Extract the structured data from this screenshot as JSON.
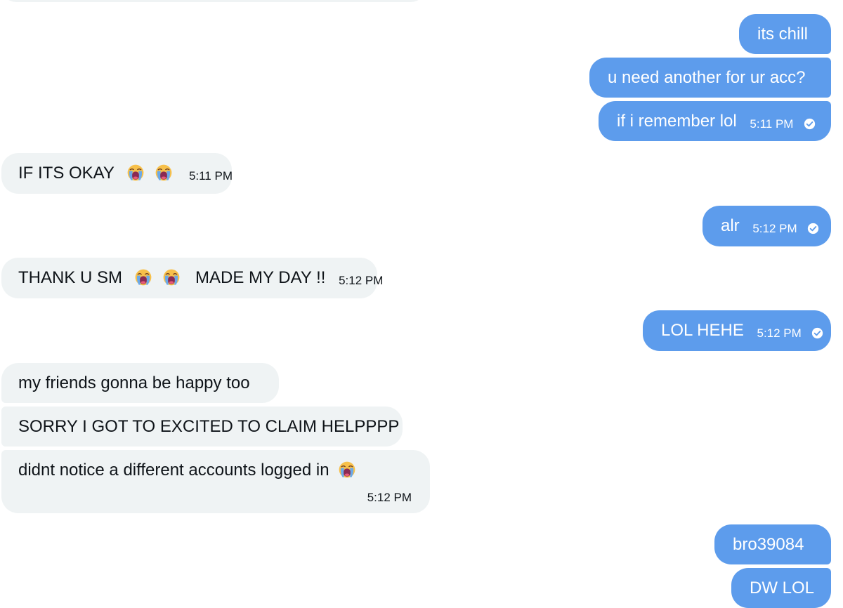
{
  "colors": {
    "incoming_bubble": "#eff3f4",
    "outgoing_bubble": "#5d9cec",
    "incoming_text": "#0f1419",
    "outgoing_text": "#ffffff"
  },
  "icons": {
    "sent_status": "checkmark-circle-icon",
    "emoji": "loudly-crying-face-emoji"
  },
  "messages": [
    {
      "text": "its chill"
    },
    {
      "text": "u need another for ur acc?"
    },
    {
      "text": "if i remember lol",
      "time": "5:11 PM"
    },
    {
      "text_before": "IF ITS OKAY",
      "time": "5:11 PM"
    },
    {
      "text": "alr",
      "time": "5:12 PM"
    },
    {
      "text_before": "THANK U SM",
      "text_after": "MADE MY DAY !!",
      "time": "5:12 PM"
    },
    {
      "text": "LOL HEHE",
      "time": "5:12 PM"
    },
    {
      "text": "my friends gonna be happy too"
    },
    {
      "text": "SORRY I GOT TO EXCITED TO CLAIM HELPPPP"
    },
    {
      "text": "didnt notice a different accounts logged in",
      "time": "5:12 PM"
    },
    {
      "text": "bro39084"
    },
    {
      "text": "DW LOL"
    }
  ]
}
